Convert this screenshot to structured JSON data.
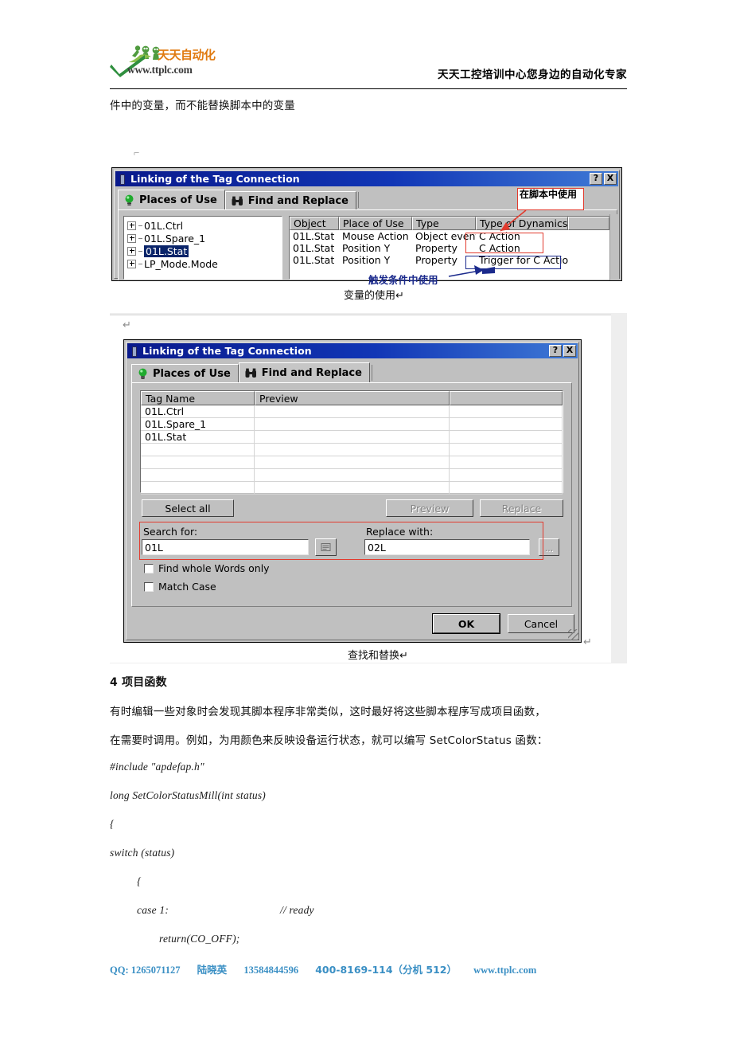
{
  "header": {
    "logo_cn": "天天自动化",
    "logo_url": "www.ttplc.com",
    "slogan": "天天工控培训中心您身边的自动化专家"
  },
  "intro_line": "件中的变量，而不能替换脚本中的变量",
  "figure1": {
    "title": "Linking of the Tag Connection",
    "help_btn": "?",
    "close_btn": "X",
    "tabs": [
      {
        "label": "Places of Use",
        "icon": "lightbulb-icon",
        "active": true
      },
      {
        "label": "Find and Replace",
        "icon": "binoculars-icon",
        "active": false
      }
    ],
    "tree_items": [
      {
        "label": "01L.Ctrl",
        "selected": false
      },
      {
        "label": "01L.Spare_1",
        "selected": false
      },
      {
        "label": "01L.Stat",
        "selected": true
      },
      {
        "label": "LP_Mode.Mode",
        "selected": false
      }
    ],
    "grid_headers": [
      "Object",
      "Place of Use",
      "Type",
      "Type of Dynamics",
      ""
    ],
    "grid_rows": [
      [
        "01L.Stat",
        "Mouse Action",
        "Object event",
        "C Action",
        ""
      ],
      [
        "01L.Stat",
        "Position Y",
        "Property",
        "C Action",
        ""
      ],
      [
        "01L.Stat",
        "Position Y",
        "Property",
        "Trigger for C Action",
        ""
      ]
    ],
    "annotation_script": "在脚本中使用",
    "annotation_trigger": "触发条件中使用",
    "caption": "变量的使用↵"
  },
  "figure2": {
    "title": "Linking of the Tag Connection",
    "help_btn": "?",
    "close_btn": "X",
    "tabs": [
      {
        "label": "Places of Use",
        "icon": "lightbulb-icon",
        "active": false
      },
      {
        "label": "Find and Replace",
        "icon": "binoculars-icon",
        "active": true
      }
    ],
    "table_headers": [
      "Tag Name",
      "Preview",
      ""
    ],
    "table_rows": [
      [
        "01L.Ctrl",
        "",
        ""
      ],
      [
        "01L.Spare_1",
        "",
        ""
      ],
      [
        "01L.Stat",
        "",
        ""
      ],
      [
        "",
        "",
        ""
      ],
      [
        "",
        "",
        ""
      ],
      [
        "",
        "",
        ""
      ],
      [
        "",
        "",
        ""
      ]
    ],
    "select_all_label": "Select all",
    "preview_label": "Preview",
    "replace_label": "Replace",
    "search_label": "Search for:",
    "search_value": "01L",
    "replace_label_2": "Replace with:",
    "replace_value": "02L",
    "browse_btn_1": "",
    "browse_btn_2": "...",
    "check_whole_words": "Find whole Words only",
    "check_match_case": "Match Case",
    "ok_label": "OK",
    "cancel_label": "Cancel",
    "caption": "查找和替换↵"
  },
  "section": {
    "heading": "4 项目函数",
    "para1": "有时编辑一些对象时会发现其脚本程序非常类似，这时最好将这些脚本程序写成项目函数，",
    "para2": "在需要时调用。例如，为用颜色来反映设备运行状态，就可以编写 SetColorStatus 函数："
  },
  "code_lines": [
    {
      "text": "#include \"apdefap.h\"",
      "indent": 0
    },
    {
      "text": "long SetColorStatusMill(int status)",
      "indent": 0
    },
    {
      "text": "{",
      "indent": 0
    },
    {
      "text": "switch (status)",
      "indent": 0
    },
    {
      "text": "{",
      "indent": 1
    },
    {
      "text": "case 1:",
      "indent": 1
    },
    {
      "text": "return(CO_OFF);",
      "indent": 2
    }
  ],
  "code_comment": "// ready",
  "footer": {
    "qq": "QQ: 1265071127",
    "name": "陆晓英",
    "mobile": "13584844596",
    "hotline": "400-8169-114（分机 512）",
    "site": "www.ttplc.com"
  },
  "colors": {
    "titlebar": "#0a1a8c",
    "annotation_red": "#e23b2e",
    "annotation_blue": "#1b2a8c",
    "footer_blue": "#3a8fc4",
    "logo_orange": "#e07a10",
    "dialog_face": "#c0c0c0",
    "selection_blue": "#0a246a"
  }
}
